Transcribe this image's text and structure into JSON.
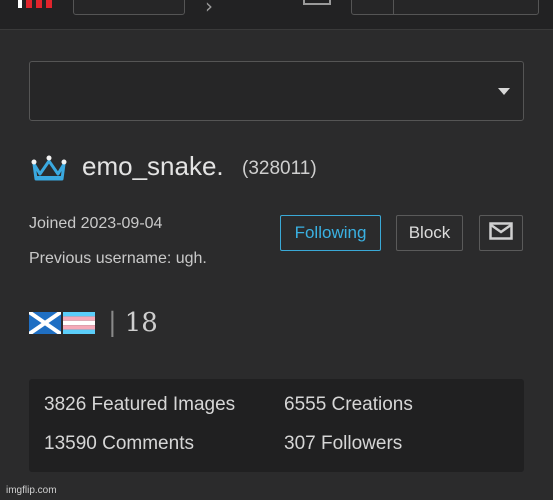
{
  "profile": {
    "username": "emo_snake.",
    "user_id": "(328011)",
    "joined": "Joined 2023-09-04",
    "previous_username": "Previous username: ugh.",
    "age_text": "18",
    "separator": "|"
  },
  "actions": {
    "following_label": "Following",
    "block_label": "Block",
    "message_icon": "mail-icon"
  },
  "stats": {
    "featured_images": "3826 Featured Images",
    "creations": "6555 Creations",
    "comments": "13590 Comments",
    "followers": "307 Followers"
  },
  "footer": {
    "watermark": "imgflip.com"
  },
  "colors": {
    "background": "#2b2b2c",
    "accent": "#3ab1e2",
    "crown": "#3aa9e0",
    "logo_red": "#e0242c"
  },
  "icons": {
    "crown": "crown-icon",
    "flag_scotland": "scotland-flag-icon",
    "flag_trans": "transgender-flag-icon"
  }
}
